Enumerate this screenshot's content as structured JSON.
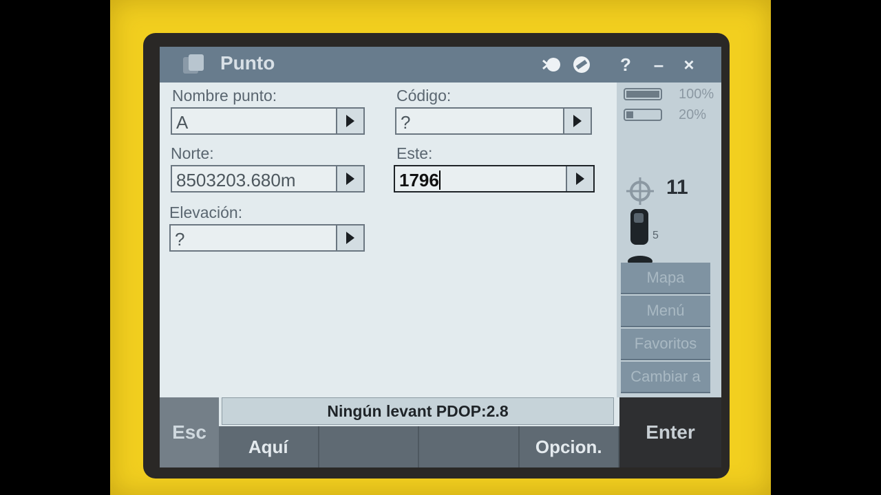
{
  "window": {
    "title": "Punto"
  },
  "titlebar_icons": [
    "connection-icon",
    "no-entry-icon"
  ],
  "titlebar_buttons": {
    "help": "?",
    "minimize": "–",
    "close": "×"
  },
  "form": {
    "point_name": {
      "label": "Nombre punto:",
      "value": "A"
    },
    "code": {
      "label": "Código:",
      "value": "?"
    },
    "north": {
      "label": "Norte:",
      "value": "8503203.680m"
    },
    "east": {
      "label": "Este:",
      "value": "1796"
    },
    "elevation": {
      "label": "Elevación:",
      "value": "?"
    }
  },
  "status": {
    "battery_1": {
      "percent": 100,
      "text": "100%"
    },
    "battery_2": {
      "percent": 20,
      "text": "20%"
    },
    "satellites": "11",
    "receiver_subscript": "5",
    "antenna_value": "?"
  },
  "side_buttons": [
    "Mapa",
    "Menú",
    "Favoritos",
    "Cambiar a"
  ],
  "status_message": "Ningún levant  PDOP:2.8",
  "softkeys": {
    "esc": "Esc",
    "k1": "Aquí",
    "k2": "",
    "k3": "",
    "k4": "Opcion.",
    "enter": "Enter"
  }
}
